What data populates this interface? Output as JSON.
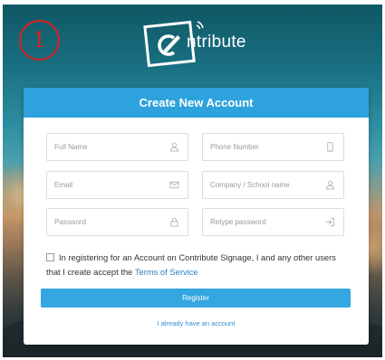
{
  "step_badge": "1",
  "logo": {
    "brand_text": "ntribute",
    "icon": "contribute-logo-icon"
  },
  "form": {
    "title": "Create New Account",
    "fields": {
      "full_name": {
        "placeholder": "Full Name",
        "icon": "user-icon"
      },
      "phone_number": {
        "placeholder": "Phone Number",
        "icon": "mobile-phone-icon"
      },
      "email": {
        "placeholder": "Email",
        "icon": "envelope-icon"
      },
      "company": {
        "placeholder": "Company / School name",
        "icon": "user-icon"
      },
      "password": {
        "placeholder": "Password",
        "icon": "lock-icon"
      },
      "retype_password": {
        "placeholder": "Retype password",
        "icon": "sign-in-icon"
      }
    },
    "terms": {
      "text": "In registering for an Account on Contribute Signage, I and any other users that I create accept the ",
      "link_text": "Terms of Service"
    },
    "register_label": "Register",
    "login_link": "I already have an account"
  },
  "colors": {
    "accent": "#2ea2dc",
    "button": "#34a6e0",
    "link": "#2a7fc1",
    "badge": "#d42222"
  }
}
